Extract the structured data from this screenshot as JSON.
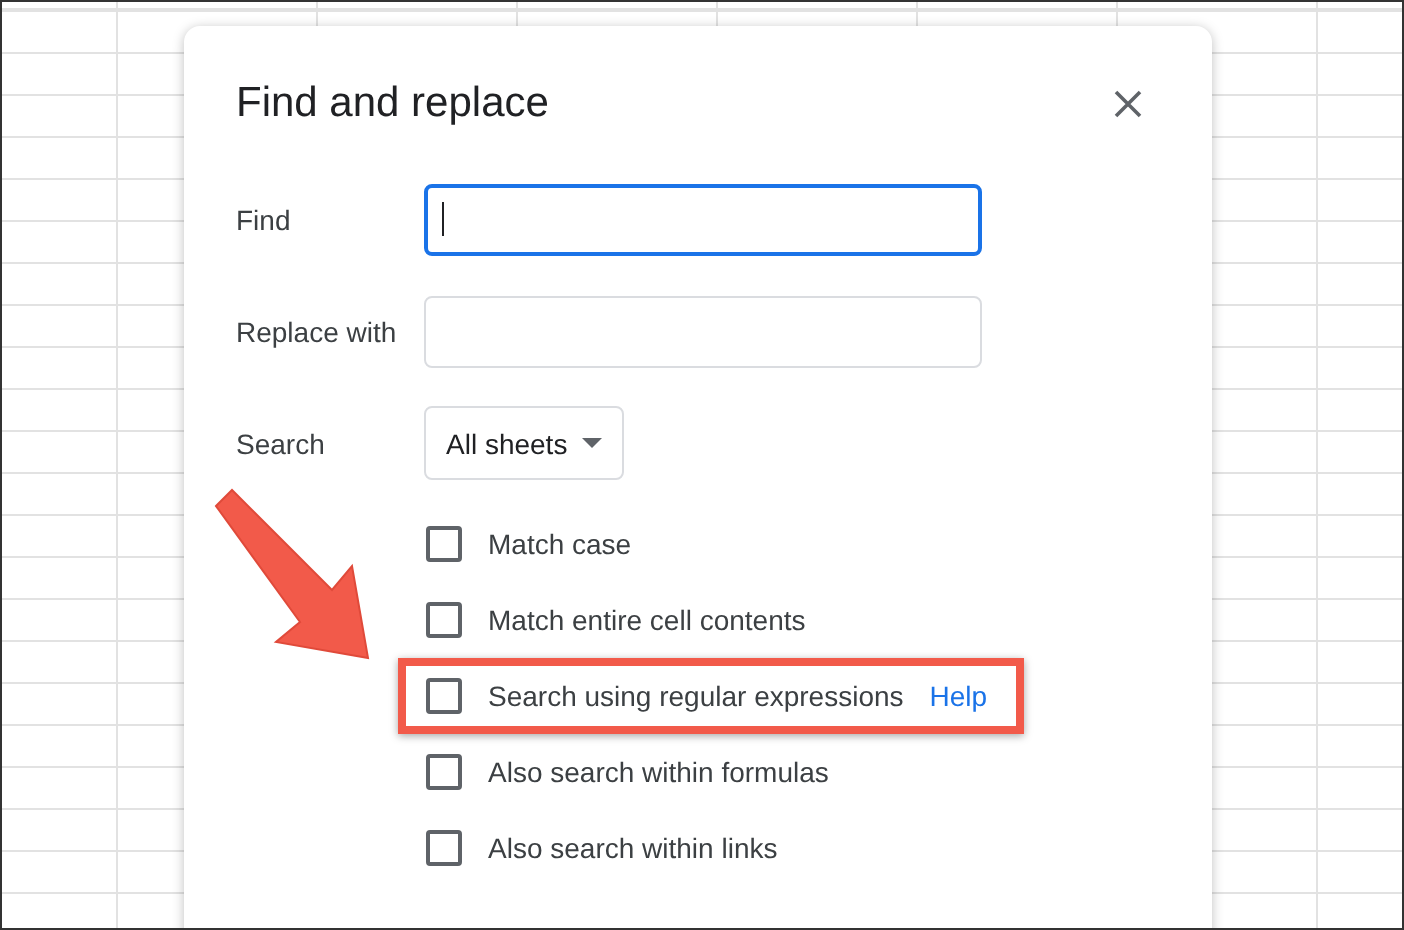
{
  "dialog": {
    "title": "Find and replace",
    "fields": [
      {
        "label": "Find",
        "kind": "input",
        "focused": true
      },
      {
        "label": "Replace with",
        "kind": "input",
        "focused": false
      },
      {
        "label": "Search",
        "kind": "dropdown",
        "value": "All sheets",
        "focused": false
      }
    ],
    "options": [
      {
        "label": "Match case",
        "checked": false,
        "highlighted": false
      },
      {
        "label": "Match entire cell contents",
        "checked": false,
        "highlighted": false
      },
      {
        "label": "Search using regular expressions",
        "link": "Help",
        "checked": false,
        "highlighted": true
      },
      {
        "label": "Also search within formulas",
        "checked": false,
        "highlighted": false
      },
      {
        "label": "Also search within links",
        "checked": false,
        "highlighted": false
      }
    ]
  }
}
